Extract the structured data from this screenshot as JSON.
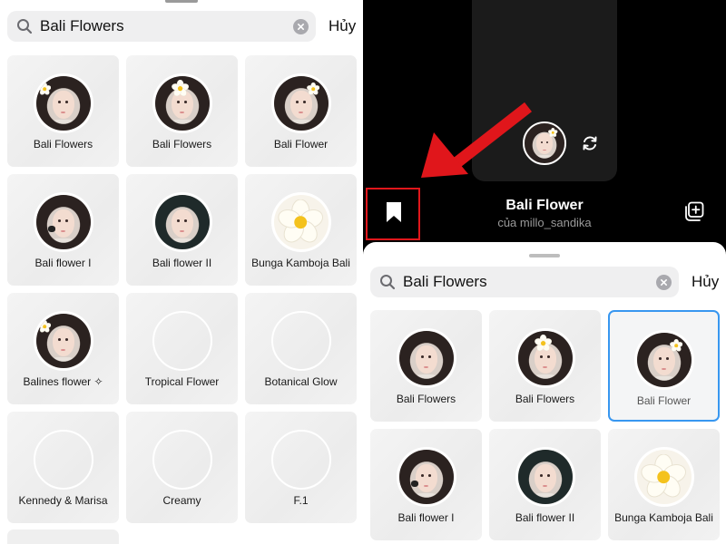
{
  "left": {
    "search": {
      "value": "Bali Flowers",
      "cancel_label": "Hủy"
    },
    "effects": [
      {
        "label": "Bali Flowers",
        "thumb": "girl-flower-left"
      },
      {
        "label": "Bali Flowers",
        "thumb": "girl-flower-top"
      },
      {
        "label": "Bali Flower",
        "thumb": "girl-flower-right"
      },
      {
        "label": "Bali flower I",
        "thumb": "girl-bow"
      },
      {
        "label": "Bali flower II",
        "thumb": "girl-dark-hair"
      },
      {
        "label": "Bunga Kamboja Bali",
        "thumb": "frangipani"
      },
      {
        "label": "Balines flower ✧",
        "thumb": "girl-flower-left"
      },
      {
        "label": "Tropical Flower",
        "thumb": "empty"
      },
      {
        "label": "Botanical Glow",
        "thumb": "empty"
      },
      {
        "label": "Kennedy & Marisa",
        "thumb": "empty"
      },
      {
        "label": "Creamy",
        "thumb": "empty"
      },
      {
        "label": "F.1",
        "thumb": "empty"
      }
    ]
  },
  "right": {
    "effect_title": "Bali Flower",
    "effect_author": "của millo_sandika",
    "annotation_color": "#e0161b",
    "sheet": {
      "search": {
        "value": "Bali Flowers",
        "cancel_label": "Hủy"
      },
      "effects": [
        {
          "label": "Bali Flowers",
          "thumb": "girl-plain"
        },
        {
          "label": "Bali Flowers",
          "thumb": "girl-flower-top"
        },
        {
          "label": "Bali Flower",
          "thumb": "girl-flower-right",
          "selected": true
        },
        {
          "label": "Bali flower I",
          "thumb": "girl-bow"
        },
        {
          "label": "Bali flower II",
          "thumb": "girl-dark-hair"
        },
        {
          "label": "Bunga Kamboja Bali",
          "thumb": "frangipani"
        }
      ]
    },
    "selected_color": "#3897f0"
  }
}
